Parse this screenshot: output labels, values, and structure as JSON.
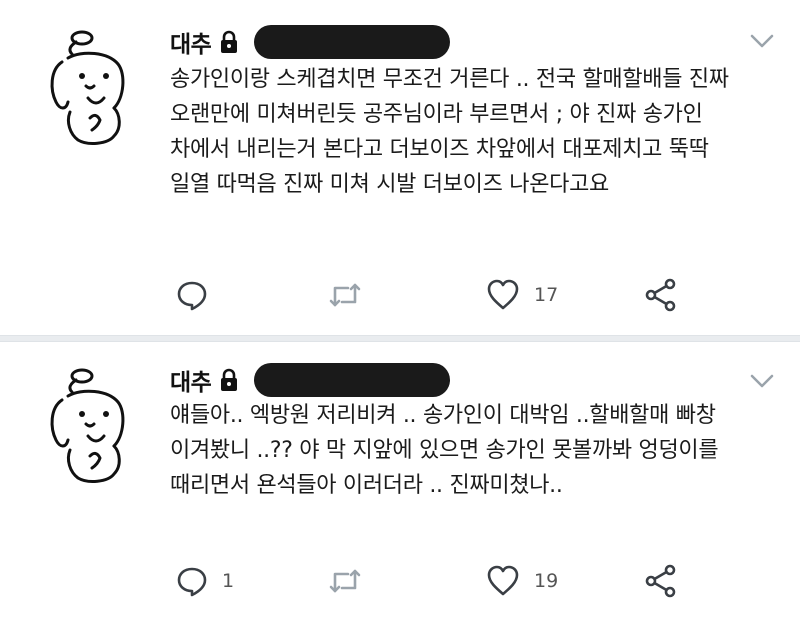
{
  "tweets": [
    {
      "name": "대추",
      "text_lines": [
        "송가인이랑 스케겹치면 무조건 거른다 .. 전국 할매할배들 진짜",
        "오랜만에 미쳐버린듯 공주님이라 부르면서 ; 야 진짜 송가인",
        "차에서 내리는거 본다고 더보이즈 차앞에서 대포제치고 뚝딱",
        "일열 따먹음 진짜 미쳐 시발 더보이즈 나온다고요"
      ],
      "reply_count": "",
      "retweet_count": "",
      "like_count": "17"
    },
    {
      "name": "대추",
      "text_lines": [
        "얘들아.. 엑방원 저리비켜 .. 송가인이 대박임 ..할배할매 빠창",
        "이겨봤니 ..?? 야 막 지앞에 있으면 송가인 못볼까봐 엉덩이를",
        "때리면서 욘석들아 이러더라 .. 진짜미쳤나.."
      ],
      "reply_count": "1",
      "retweet_count": "",
      "like_count": "19"
    }
  ],
  "icons": {
    "avatar": "dog-avatar",
    "lock": "lock-icon",
    "chevron": "chevron-down-icon",
    "reply": "reply-icon",
    "retweet": "retweet-icon",
    "like": "heart-icon",
    "share": "share-icon"
  },
  "colors": {
    "icon": "#3a3f45",
    "divider": "#e9ecef",
    "text": "#1b1b1b"
  }
}
